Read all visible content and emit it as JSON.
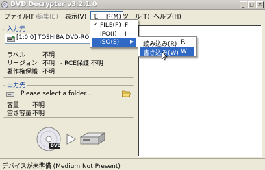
{
  "window": {
    "title": "DVD Decrypter v3.2.1.0",
    "buttons": {
      "minimize": "_",
      "maximize": "□",
      "close": "×"
    }
  },
  "menubar": [
    {
      "label": "ファイル(F)",
      "state": "normal"
    },
    {
      "label": "編集(E)",
      "state": "disabled"
    },
    {
      "label": "表示(V)",
      "state": "normal"
    },
    {
      "label": "モード(M)",
      "state": "open"
    },
    {
      "label": "ツール(T)",
      "state": "normal"
    },
    {
      "label": "ヘルプ(H)",
      "state": "normal"
    }
  ],
  "source": {
    "title": "入力元",
    "drive": "[1:0:0] TOSHIBA DVD-ROM",
    "label_key": "ラベル",
    "label_value": "不明",
    "region_key": "リージョン",
    "region_value": "不明",
    "rce_text": "- RCE保護 不明",
    "copyright_key": "著作権保護",
    "copyright_value": "不明"
  },
  "destination": {
    "title": "出力先",
    "folder_placeholder": "Please select a folder...",
    "capacity_key": "容量",
    "capacity_value": "不明",
    "free_key": "空き容量",
    "free_value": "不明"
  },
  "mode_menu": {
    "items": [
      {
        "label": "FILE(F)",
        "key": "F",
        "checked": true
      },
      {
        "label": "IFO(I)",
        "key": "I",
        "checked": false
      },
      {
        "label": "ISO(S)",
        "key": "",
        "checked": false,
        "submenu": true,
        "selected": true
      }
    ]
  },
  "iso_submenu": {
    "items": [
      {
        "label": "読み込み(R)",
        "key": "R",
        "selected": false
      },
      {
        "label": "書き込み(W)",
        "key": "W",
        "selected": true
      }
    ]
  },
  "disc_badge": "DVD",
  "status": "デバイスが未準備 (Medium Not Present)"
}
